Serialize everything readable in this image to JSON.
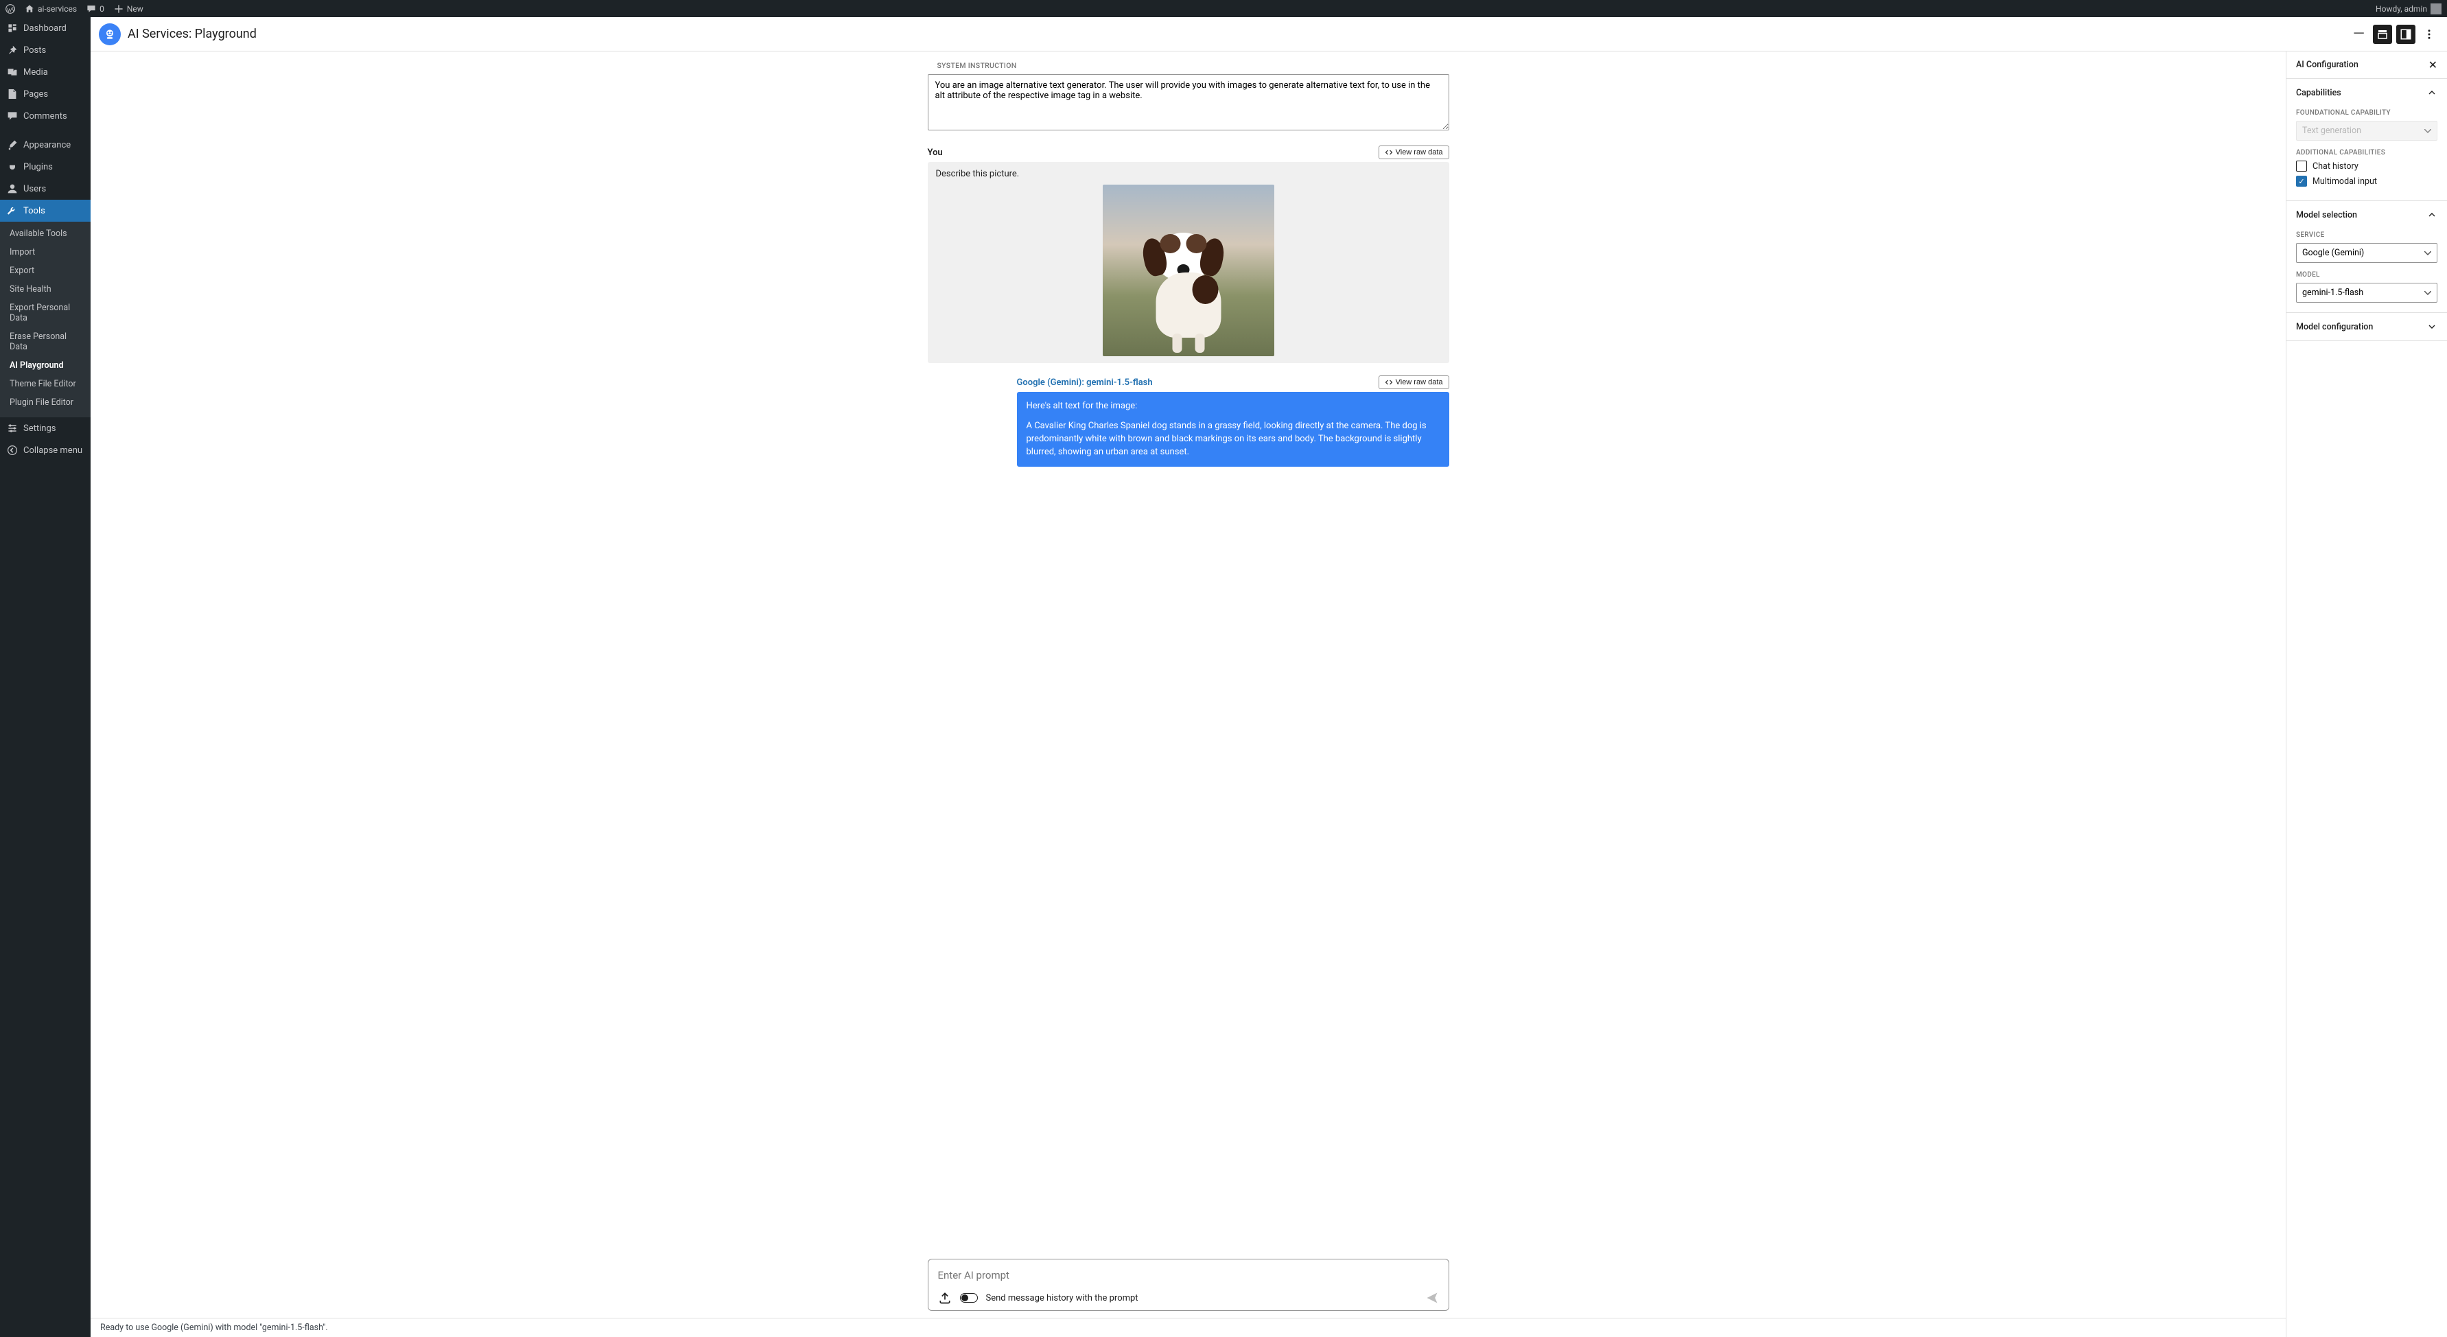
{
  "adminBar": {
    "siteName": "ai-services",
    "comments": "0",
    "new": "New",
    "greeting": "Howdy, admin"
  },
  "sidebar": {
    "items": [
      {
        "label": "Dashboard",
        "icon": "dash"
      },
      {
        "label": "Posts",
        "icon": "pin"
      },
      {
        "label": "Media",
        "icon": "media"
      },
      {
        "label": "Pages",
        "icon": "page"
      },
      {
        "label": "Comments",
        "icon": "comment"
      },
      {
        "label": "Appearance",
        "icon": "brush"
      },
      {
        "label": "Plugins",
        "icon": "plug"
      },
      {
        "label": "Users",
        "icon": "user"
      },
      {
        "label": "Tools",
        "icon": "wrench",
        "active": true
      }
    ],
    "toolsSub": [
      {
        "label": "Available Tools"
      },
      {
        "label": "Import"
      },
      {
        "label": "Export"
      },
      {
        "label": "Site Health"
      },
      {
        "label": "Export Personal Data"
      },
      {
        "label": "Erase Personal Data"
      },
      {
        "label": "AI Playground",
        "current": true
      },
      {
        "label": "Theme File Editor"
      },
      {
        "label": "Plugin File Editor"
      }
    ],
    "after": [
      {
        "label": "Settings",
        "icon": "sliders"
      },
      {
        "label": "Collapse menu",
        "icon": "collapse"
      }
    ]
  },
  "page": {
    "title": "AI Services: Playground"
  },
  "systemInstruction": {
    "label": "SYSTEM INSTRUCTION",
    "value": "You are an image alternative text generator. The user will provide you with images to generate alternative text for, to use in the alt attribute of the respective image tag in a website."
  },
  "conversation": {
    "user": {
      "author": "You",
      "viewRaw": "View raw data",
      "text": "Describe this picture."
    },
    "model": {
      "author": "Google (Gemini): gemini-1.5-flash",
      "viewRaw": "View raw data",
      "para1": "Here's alt text for the image:",
      "para2": "A Cavalier King Charles Spaniel dog stands in a grassy field, looking directly at the camera. The dog is predominantly white with brown and black markings on its ears and body. The background is slightly blurred, showing an urban area at sunset."
    }
  },
  "prompt": {
    "placeholder": "Enter AI prompt",
    "historyToggle": "Send message history with the prompt"
  },
  "status": "Ready to use Google (Gemini) with model \"gemini-1.5-flash\".",
  "config": {
    "title": "AI Configuration",
    "capabilities": {
      "heading": "Capabilities",
      "foundLabel": "FOUNDATIONAL CAPABILITY",
      "foundValue": "Text generation",
      "addlLabel": "ADDITIONAL CAPABILITIES",
      "chatHistory": "Chat history",
      "multimodal": "Multimodal input"
    },
    "modelSel": {
      "heading": "Model selection",
      "serviceLabel": "SERVICE",
      "serviceValue": "Google (Gemini)",
      "modelLabel": "MODEL",
      "modelValue": "gemini-1.5-flash"
    },
    "modelConfig": {
      "heading": "Model configuration"
    }
  }
}
